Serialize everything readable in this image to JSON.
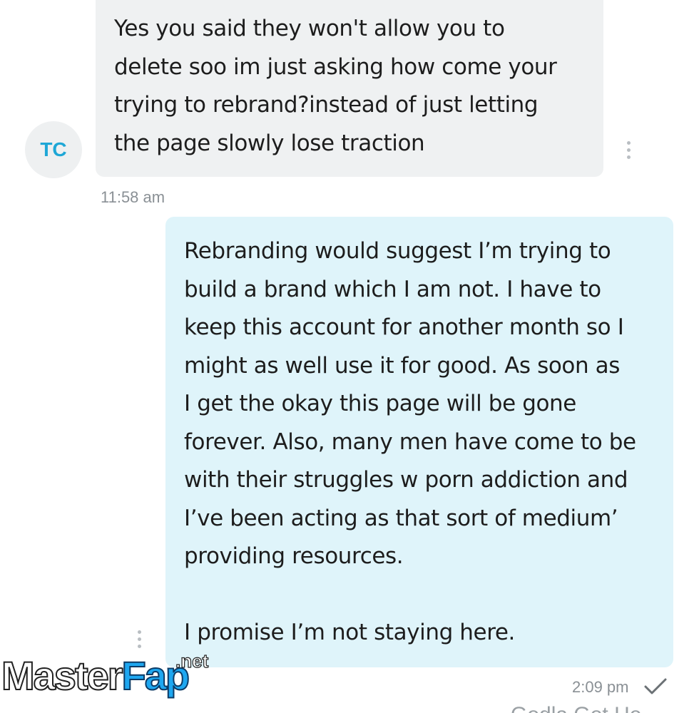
{
  "conversation": {
    "incoming": {
      "avatar_initials": "TC",
      "text": "Yes you said they won't allow you to\ndelete soo im just asking how come your\ntrying to rebrand?instead of just letting\nthe page slowly lose traction",
      "time": "11:58 am"
    },
    "outgoing": {
      "text": "Rebranding would suggest I’m trying to\nbuild a brand which I am not. I have to\nkeep this account for another month so I\nmight as well use it for good. As soon as\nI get the okay this page will be gone\nforever. Also, many men have come to be\nwith their struggles w porn addiction and\nI’ve been acting as that sort of medium’\nproviding resources.\n\nI promise I’m not staying here.",
      "time": "2:09 pm",
      "status_icon": "check-icon"
    },
    "partial_next_label": "Godla Got He"
  },
  "watermark": {
    "part1": "Master",
    "part2": "Fap",
    "suffix": ".net"
  },
  "colors": {
    "incoming_bubble": "#eff1f2",
    "outgoing_bubble": "#dff4fa",
    "avatar_text": "#1ea7d6",
    "timestamp": "#8a9095"
  }
}
